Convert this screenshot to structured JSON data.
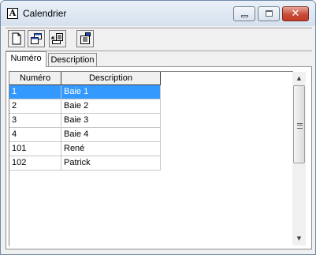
{
  "window": {
    "title": "Calendrier"
  },
  "toolbar": {
    "buttons": [
      {
        "name": "new-document-icon"
      },
      {
        "name": "duplicate-window-icon"
      },
      {
        "name": "export-icon"
      },
      {
        "name": "properties-icon"
      }
    ]
  },
  "tabs": [
    {
      "label": "Numéro",
      "active": true
    },
    {
      "label": "Description",
      "active": false
    }
  ],
  "table": {
    "columns": [
      "Numéro",
      "Description"
    ],
    "rows": [
      {
        "numero": "1",
        "description": "Baie 1",
        "selected": true
      },
      {
        "numero": "2",
        "description": "Baie 2",
        "selected": false
      },
      {
        "numero": "3",
        "description": "Baie 3",
        "selected": false
      },
      {
        "numero": "4",
        "description": "Baie 4",
        "selected": false
      },
      {
        "numero": "101",
        "description": "René",
        "selected": false
      },
      {
        "numero": "102",
        "description": "Patrick",
        "selected": false
      }
    ]
  },
  "colors": {
    "selection": "#3399ff",
    "close_button": "#c74c3a"
  }
}
